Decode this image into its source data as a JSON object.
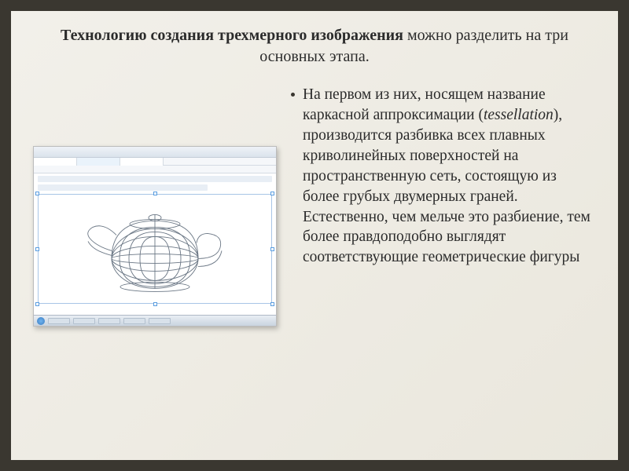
{
  "title_bold": "Технологию создания трехмерного изображения",
  "title_rest": " можно разделить на три основных этапа.",
  "bullet_pre": "На первом из них, носящем название каркасной аппроксимации (",
  "bullet_ital": "tessellation",
  "bullet_post": "), производится разбивка всех плавных криволинейных поверхностей на пространственную сеть, состоящую из более грубых двумерных граней. Естественно, чем мельче это разбиение, тем более правдоподобно выглядят соответствующие геометрические фигуры",
  "teapot_alt": "wireframe-teapot"
}
